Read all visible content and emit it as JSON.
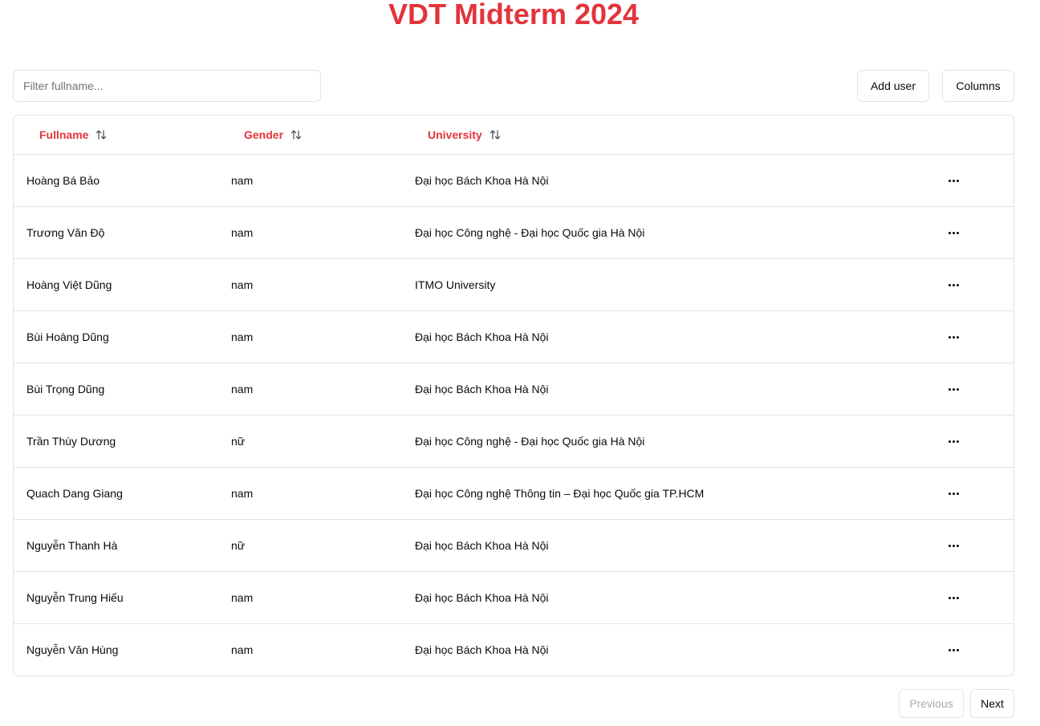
{
  "header": {
    "title": "VDT Midterm 2024"
  },
  "toolbar": {
    "filter_placeholder": "Filter fullname...",
    "filter_value": "",
    "add_user_label": "Add user",
    "columns_label": "Columns"
  },
  "table": {
    "columns": [
      {
        "label": "Fullname",
        "icon": "sort-arrows-icon"
      },
      {
        "label": "Gender",
        "icon": "sort-arrows-icon"
      },
      {
        "label": "University",
        "icon": "sort-arrows-icon"
      }
    ],
    "rows": [
      {
        "fullname": "Hoàng Bá Bảo",
        "gender": "nam",
        "university": "Đại học Bách Khoa Hà Nội"
      },
      {
        "fullname": "Trương Văn Độ",
        "gender": "nam",
        "university": "Đại học Công nghệ - Đại học Quốc gia Hà Nội"
      },
      {
        "fullname": "Hoàng Việt Dũng",
        "gender": "nam",
        "university": "ITMO University"
      },
      {
        "fullname": "Bùi Hoàng Dũng",
        "gender": "nam",
        "university": "Đại học Bách Khoa Hà Nội"
      },
      {
        "fullname": "Bùi Trọng Dũng",
        "gender": "nam",
        "university": "Đại học Bách Khoa Hà Nội"
      },
      {
        "fullname": "Trần Thùy Dương",
        "gender": "nữ",
        "university": "Đại học Công nghệ - Đại học Quốc gia Hà Nội"
      },
      {
        "fullname": "Quach Dang Giang",
        "gender": "nam",
        "university": "Đại học Công nghệ Thông tin – Đại học Quốc gia TP.HCM"
      },
      {
        "fullname": "Nguyễn Thanh Hà",
        "gender": "nữ",
        "university": "Đại học Bách Khoa Hà Nội"
      },
      {
        "fullname": "Nguyễn Trung Hiếu",
        "gender": "nam",
        "university": "Đại học Bách Khoa Hà Nội"
      },
      {
        "fullname": "Nguyễn Văn Hùng",
        "gender": "nam",
        "university": "Đại học Bách Khoa Hà Nội"
      }
    ],
    "row_action_icon": "more-horizontal-icon"
  },
  "pagination": {
    "previous_label": "Previous",
    "next_label": "Next",
    "previous_disabled": true
  },
  "colors": {
    "accent": "#e3343c",
    "border": "#e4e4e7",
    "muted_text": "#a1a1aa"
  }
}
